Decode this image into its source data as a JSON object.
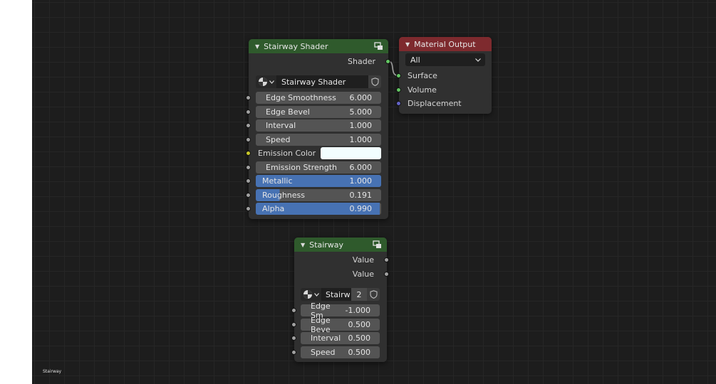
{
  "status_label": "Stairway",
  "nodes": {
    "stairway_shader": {
      "title": "Stairway Shader",
      "output": "Shader",
      "datablock_name": "Stairway Shader",
      "inputs": [
        {
          "label": "Edge Smoothness",
          "value": "6.000"
        },
        {
          "label": "Edge Bevel",
          "value": "5.000"
        },
        {
          "label": "Interval",
          "value": "1.000"
        },
        {
          "label": "Speed",
          "value": "1.000"
        }
      ],
      "emission_color_label": "Emission Color",
      "emission_color": "#f2feff",
      "emission_strength": {
        "label": "Emission Strength",
        "value": "6.000"
      },
      "factors": [
        {
          "label": "Metallic",
          "value": "1.000",
          "fill": 1.0
        },
        {
          "label": "Roughness",
          "value": "0.191",
          "fill": 0.191
        },
        {
          "label": "Alpha",
          "value": "0.990",
          "fill": 0.99
        }
      ]
    },
    "material_output": {
      "title": "Material Output",
      "target": "All",
      "inputs": [
        "Surface",
        "Volume",
        "Displacement"
      ]
    },
    "stairway": {
      "title": "Stairway",
      "outputs": [
        "Value",
        "Value"
      ],
      "datablock_name": "Stairw",
      "users": "2",
      "inputs": [
        {
          "label": "Edge Sm",
          "value": "-1.000"
        },
        {
          "label": "Edge Beve",
          "value": "0.500"
        },
        {
          "label": "Interval",
          "value": "0.500"
        },
        {
          "label": "Speed",
          "value": "0.500"
        }
      ]
    }
  },
  "colors": {
    "shader_socket": "#63c763",
    "value_socket": "#a1a1a1",
    "color_socket": "#c7c729",
    "vector_socket": "#6363c7",
    "group_header": "#2f5a2c",
    "output_header": "#7e2a2e",
    "factor_fill": "#4772b3"
  },
  "icons": [
    "node-group-icon",
    "material-sphere-icon",
    "fake-user-shield-icon",
    "collapse-arrow-icon",
    "dropdown-chevron-icon"
  ]
}
